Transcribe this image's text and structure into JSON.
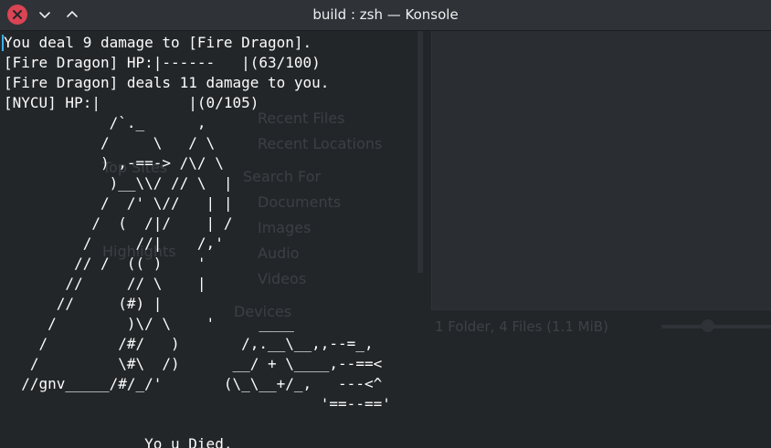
{
  "window": {
    "title": "build : zsh — Konsole",
    "icons": {
      "close": "close-icon",
      "minimize": "chevron-down-icon",
      "maximize": "chevron-up-icon"
    },
    "accent": "#da4453"
  },
  "terminal": {
    "text": "You deal 9 damage to [Fire Dragon].\n[Fire Dragon] HP:|------   |(63/100)\n[Fire Dragon] deals 11 damage to you.\n[NYCU] HP:|          |(0/105)\n            /`._      ,\n           /     \\   / \\\n           ) ,-==-> /\\/ \\\n            )__\\\\/ // \\  |\n           /  /' \\//   | |\n          /  (  /|/    | /\n         /     //|    /,'\n        // /  (( )    '\n       //     // \\    |\n      //     (#) |\n     /        )\\/ \\    '     ____\n    /        /#/   )       /,.__\\__,,--=_,\n   /         \\#\\  /)      __/ + \\____,--==<\n  //gnv_____/#/_/'       (\\_\\__+/_,   ---<^\n                                    '==--=='\n\n                Yo u Died."
  },
  "ghost": {
    "items": [
      "Recent Files",
      "Recent Locations",
      "Search For",
      "Documents",
      "Images",
      "Audio",
      "Videos",
      "Devices",
      "Top Sites",
      "Highlights"
    ],
    "status": "1 Folder, 4 Files (1.1 MiB)"
  }
}
